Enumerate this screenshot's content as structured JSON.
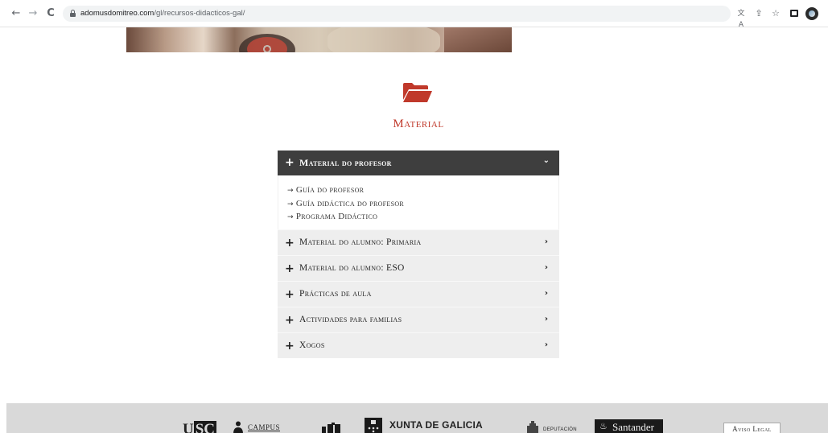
{
  "browser": {
    "url_domain": "adomusdomitreo.com",
    "url_path": "/gl/recursos-didacticos-gal/",
    "icons": [
      "back-icon",
      "forward-icon",
      "reload-icon",
      "lock-icon",
      "translate-icon",
      "share-icon",
      "star-icon",
      "side-panel-icon",
      "profile-icon"
    ]
  },
  "page": {
    "section_title": "Material",
    "section_icon": "folder-open-icon",
    "accent_color": "#c0392b"
  },
  "accordion": {
    "open_item": {
      "label": "Material do profesor",
      "links": [
        {
          "arrow": "→",
          "label": "Guía do profesor"
        },
        {
          "arrow": "→",
          "label": "Guía didáctica do profesor"
        },
        {
          "arrow": "→",
          "label": "Programa Didáctico"
        }
      ]
    },
    "items": [
      {
        "label": "Material do alumno: Primaria"
      },
      {
        "label": "Material do alumno: ESO"
      },
      {
        "label": "Prácticas de aula"
      },
      {
        "label": "Actividades para familias"
      },
      {
        "label": "Xogos"
      }
    ]
  },
  "footer": {
    "logos": {
      "usc_u": "U",
      "usc_sc": "SC",
      "campus": "CAMPUS",
      "xunta": "XUNTA DE GALICIA",
      "deputacion": "DEPUTACIÓN",
      "santander": "Santander"
    },
    "legal_label": "Aviso Legal"
  }
}
